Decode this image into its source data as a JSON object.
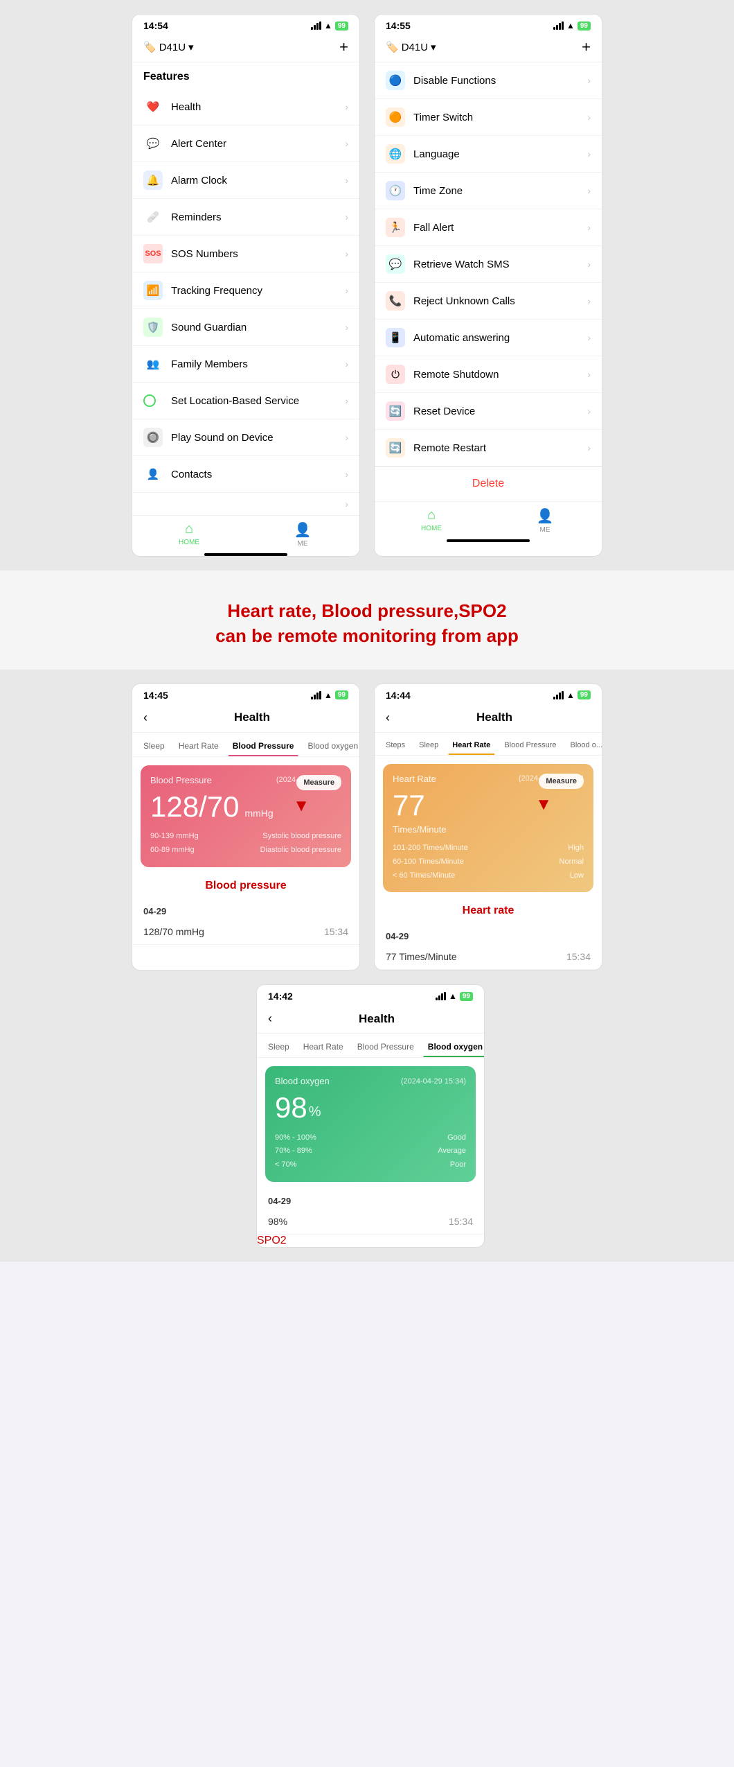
{
  "screen1": {
    "time": "14:54",
    "battery": "99",
    "device": "D41U",
    "add_btn": "+",
    "section_title": "Features",
    "menu_items": [
      {
        "label": "Health",
        "icon": "❤️",
        "color": "#ff4d4d"
      },
      {
        "label": "Alert Center",
        "icon": "💬",
        "color": "#ff8c00"
      },
      {
        "label": "Alarm Clock",
        "icon": "🔵",
        "color": "#007aff"
      },
      {
        "label": "Reminders",
        "icon": "🩹",
        "color": "#ff3b30"
      },
      {
        "label": "SOS Numbers",
        "icon": "🆘",
        "color": "#ff3b30"
      },
      {
        "label": "Tracking Frequency",
        "icon": "📡",
        "color": "#30b0ff"
      },
      {
        "label": "Sound Guardian",
        "icon": "🛡️",
        "color": "#30b050"
      },
      {
        "label": "Family Members",
        "icon": "👥",
        "color": "#5856d6"
      },
      {
        "label": "Set Location-Based Service",
        "icon": "📍",
        "color": "#34c759"
      },
      {
        "label": "Play Sound on Device",
        "icon": "🔔",
        "color": "#8e8e93"
      },
      {
        "label": "Contacts",
        "icon": "👤",
        "color": "#007aff"
      }
    ],
    "footer_tabs": [
      {
        "label": "HOME",
        "active": true
      },
      {
        "label": "ME",
        "active": false
      }
    ]
  },
  "screen2": {
    "time": "14:55",
    "battery": "99",
    "device": "D41U",
    "add_btn": "+",
    "menu_items": [
      {
        "label": "Disable Functions",
        "icon": "🔵",
        "color": "#5ac8fa"
      },
      {
        "label": "Timer Switch",
        "icon": "🔶",
        "color": "#ff9500"
      },
      {
        "label": "Language",
        "icon": "🌐",
        "color": "#ff9500"
      },
      {
        "label": "Time Zone",
        "icon": "🕐",
        "color": "#007aff"
      },
      {
        "label": "Fall Alert",
        "icon": "🏃",
        "color": "#ff3b30"
      },
      {
        "label": "Retrieve Watch SMS",
        "icon": "💬",
        "color": "#00c7be"
      },
      {
        "label": "Reject Unknown Calls",
        "icon": "📞",
        "color": "#ff3b30"
      },
      {
        "label": "Automatic answering",
        "icon": "📱",
        "color": "#007aff"
      },
      {
        "label": "Remote Shutdown",
        "icon": "⏻",
        "color": "#ff3b30"
      },
      {
        "label": "Reset Device",
        "icon": "🔄",
        "color": "#ff2d55"
      },
      {
        "label": "Remote Restart",
        "icon": "🔄",
        "color": "#ff9500"
      }
    ],
    "delete_btn": "Delete",
    "footer_tabs": [
      {
        "label": "HOME",
        "active": true
      },
      {
        "label": "ME",
        "active": false
      }
    ]
  },
  "banner": {
    "line1": "Heart rate, Blood pressure,SPO2",
    "line2": "can be remote monitoring from app"
  },
  "health_screen1": {
    "time": "14:45",
    "battery": "99",
    "back_label": "<",
    "title": "Health",
    "tabs": [
      "Sleep",
      "Heart Rate",
      "Blood Pressure",
      "Blood oxygen"
    ],
    "active_tab": "Blood Pressure",
    "active_tab_index": 2,
    "card": {
      "label": "Blood Pressure",
      "date": "(2024-04-29 15:34)",
      "value": "128/70",
      "unit": "mmHg",
      "measure_btn": "Measure",
      "ranges": [
        {
          "range": "90-139 mmHg",
          "label": "Systolic blood pressure"
        },
        {
          "range": "60-89 mmHg",
          "label": "Diastolic blood pressure"
        }
      ]
    },
    "caption": "Blood pressure",
    "history_date": "04-29",
    "history_items": [
      {
        "value": "128/70 mmHg",
        "time": "15:34"
      }
    ]
  },
  "health_screen2": {
    "time": "14:44",
    "battery": "99",
    "back_label": "<",
    "title": "Health",
    "tabs": [
      "Steps",
      "Sleep",
      "Heart Rate",
      "Blood Pressure",
      "Blood o..."
    ],
    "active_tab": "Heart Rate",
    "active_tab_index": 2,
    "card": {
      "label": "Heart Rate",
      "date": "(2024-04-29 15:34)",
      "value": "77",
      "unit": "Times/Minute",
      "measure_btn": "Measure",
      "ranges": [
        {
          "range": "101-200 Times/Minute",
          "label": "High"
        },
        {
          "range": "60-100 Times/Minute",
          "label": "Normal"
        },
        {
          "range": "< 60 Times/Minute",
          "label": "Low"
        }
      ]
    },
    "caption": "Heart rate",
    "history_date": "04-29",
    "history_items": [
      {
        "value": "77 Times/Minute",
        "time": "15:34"
      }
    ]
  },
  "health_screen3": {
    "time": "14:42",
    "battery": "99",
    "back_label": "<",
    "title": "Health",
    "tabs": [
      "Sleep",
      "Heart Rate",
      "Blood Pressure",
      "Blood oxygen"
    ],
    "active_tab": "Blood oxygen",
    "active_tab_index": 3,
    "card": {
      "label": "Blood oxygen",
      "date": "(2024-04-29 15:34)",
      "value": "98",
      "unit": "%",
      "ranges": [
        {
          "range": "90% - 100%",
          "label": "Good"
        },
        {
          "range": "70% - 89%",
          "label": "Average"
        },
        {
          "range": "< 70%",
          "label": "Poor"
        }
      ]
    },
    "caption": "SPO2",
    "history_date": "04-29",
    "history_items": [
      {
        "value": "98%",
        "time": "15:34"
      }
    ]
  },
  "icons": {
    "chevron": "›",
    "back": "‹",
    "home": "⌂",
    "person": "👤",
    "plus": "+",
    "wifi": "▲",
    "signal": "▲"
  }
}
